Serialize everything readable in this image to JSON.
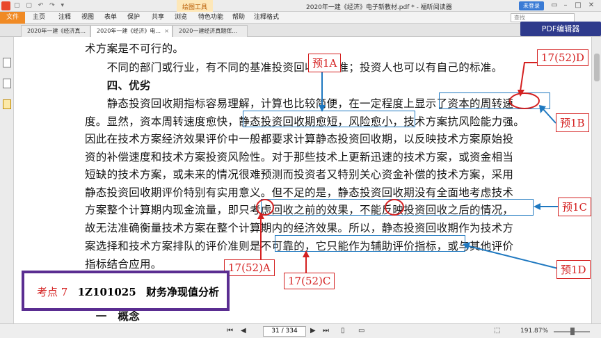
{
  "window": {
    "title": "2020年一建《经济》电子新教材.pdf * - 福昕阅读器",
    "context_tab": "绘图工具",
    "login_label": "未登录"
  },
  "menu": {
    "items": [
      "文件",
      "主页",
      "注释",
      "视图",
      "表单",
      "保护",
      "共享",
      "浏览",
      "特色功能",
      "帮助",
      "注释格式"
    ],
    "search_placeholder": "查找"
  },
  "tabs": [
    {
      "label": "2020年一建《经济真..."
    },
    {
      "label": "2020年一建《经济》电..."
    },
    {
      "label": "2020一建经济真题挥..."
    }
  ],
  "pdf_editor_label": "PDF编辑器",
  "doc": {
    "lines": [
      "术方案是不可行的。",
      "　　不同的部门或行业，有不同的基准投资回收期标准；投资人也可以有自己的标准。",
      "　　四、优劣",
      "　　静态投资回收期指标容易理解，计算也比较简便，在一定程度上显示了资本的周转速",
      "度。显然，资本周转速度愈快，静态投资回收期愈短，风险愈小，技术方案抗风险能力强。",
      "因此在技术方案经济效果评价中一般都要求计算静态投资回收期，以反映技术方案原始投",
      "资的补偿速度和技术方案投资风险性。对于那些技术上更新迅速的技术方案，或资金相当",
      "短缺的技术方案，或未来的情况很难预测而投资者又特别关心资金补偿的技术方案，采用",
      "静态投资回收期评价特别有实用意义。但不足的是，静态投资回收期没有全面地考虑技术",
      "方案整个计算期内现金流量，即只考虑回收之前的效果，不能反映投资回收之后的情况，",
      "故无法准确衡量技术方案在整个计算期内的经济效果。所以，静态投资回收期作为技术方",
      "案选择和技术方案排队的评价准则是不可靠的，它只能作为辅助评价指标，或与其他评价",
      "指标结合应用。",
      "　一　概念"
    ]
  },
  "annotations": {
    "yu1a": "预1A",
    "yu1b": "预1B",
    "yu1c": "预1C",
    "yu1d": "预1D",
    "ref_d": "17(52)D",
    "ref_a": "17(52)A",
    "ref_c": "17(52)C"
  },
  "topic": {
    "prefix": "考点 7",
    "code": "1Z101025",
    "title": "财务净现值分析"
  },
  "status": {
    "page_display": "31 / 334",
    "zoom": "191.87%"
  },
  "colors": {
    "annotation_red": "#d42020",
    "highlight_blue": "#1e78c0",
    "topic_border": "#5a2d91",
    "file_menu": "#f08a24",
    "editor_button": "#2e3a8c"
  }
}
